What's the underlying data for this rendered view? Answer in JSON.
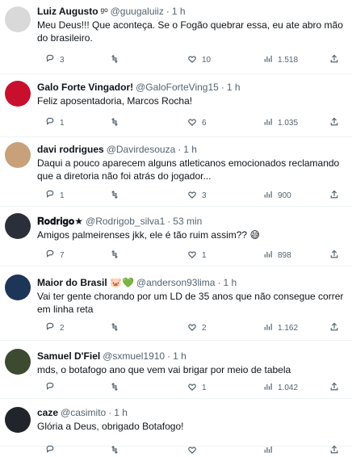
{
  "tweets": [
    {
      "name": "Luiz Augusto",
      "badge": "ᵍᵒ",
      "handle": "@guugaluiiz",
      "time": "1 h",
      "text": "Meu Deus!!! Que aconteça. Se o Fogão quebrar essa, eu ate abro mão do brasileiro.",
      "replies": "3",
      "retweets": "",
      "likes": "10",
      "views": "1.518",
      "avatar_color": "#d9d9d9"
    },
    {
      "name": "Galo Forte Vingador!",
      "badge": "",
      "handle": "@GaloForteVing15",
      "time": "1 h",
      "text": "Feliz aposentadoria, Marcos Rocha!",
      "replies": "1",
      "retweets": "",
      "likes": "6",
      "views": "1.035",
      "avatar_color": "#c8102e"
    },
    {
      "name": "davi rodrigues",
      "badge": "",
      "handle": "@Davirdesouza",
      "time": "1 h",
      "text": "Daqui a pouco aparecem alguns atleticanos emocionados reclamando que a diretoria não foi atrás do jogador...",
      "replies": "1",
      "retweets": "",
      "likes": "3",
      "views": "900",
      "avatar_color": "#c8a07a"
    },
    {
      "name": "𝐑𝐨𝐝𝐫𝐢𝐠𝐨★",
      "badge": "",
      "handle": "@Rodrigob_silva1",
      "time": "53 min",
      "text": "Amigos palmeirenses jkk, ele é tão ruim assim?? 😅",
      "replies": "7",
      "retweets": "",
      "likes": "1",
      "views": "898",
      "avatar_color": "#2b2f3a"
    },
    {
      "name": "Maior do Brasil 🐷💚",
      "badge": "",
      "handle": "@anderson93lima",
      "time": "1 h",
      "text": "Vai ter gente chorando por um LD de 35 anos que não consegue correr em linha reta",
      "replies": "2",
      "retweets": "",
      "likes": "2",
      "views": "1.162",
      "avatar_color": "#1d3557"
    },
    {
      "name": "Samuel D'Fiel",
      "badge": "",
      "handle": "@sxmuel1910",
      "time": "1 h",
      "text": "mds, o botafogo ano que vem vai brigar por meio de tabela",
      "replies": "",
      "retweets": "",
      "likes": "1",
      "views": "1.042",
      "avatar_color": "#3c4a2f"
    },
    {
      "name": "caze",
      "badge": "",
      "handle": "@casimito",
      "time": "1 h",
      "text": "Glória a Deus, obrigado Botafogo!",
      "replies": "",
      "retweets": "",
      "likes": "",
      "views": "",
      "avatar_color": "#22242b"
    }
  ],
  "icons": {
    "reply": "reply-icon",
    "retweet": "retweet-icon",
    "like": "like-icon",
    "views": "views-icon",
    "share": "share-icon"
  }
}
